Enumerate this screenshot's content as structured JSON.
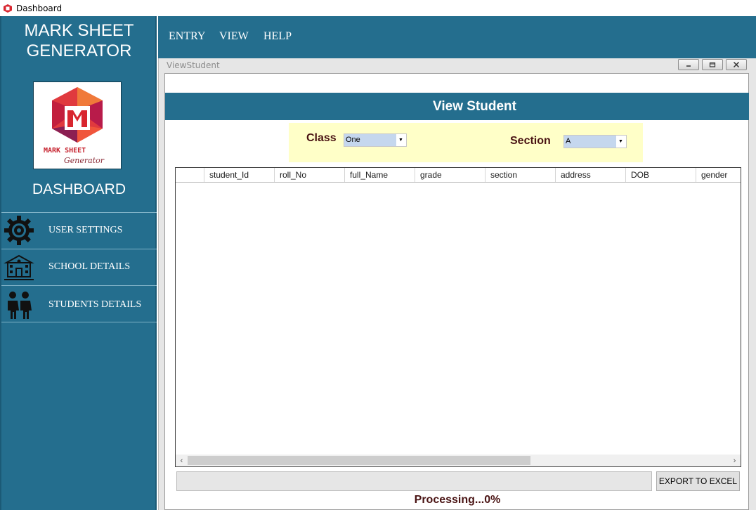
{
  "window": {
    "title": "Dashboard"
  },
  "sidebar": {
    "brand": "MARK SHEET GENERATOR",
    "logo": {
      "line1": "MARK SHEET",
      "line2": "Generator"
    },
    "dashboard_label": "DASHBOARD",
    "items": [
      {
        "label": "USER SETTINGS",
        "icon": "gear-icon"
      },
      {
        "label": "SCHOOL DETAILS",
        "icon": "school-icon"
      },
      {
        "label": "STUDENTS DETAILS",
        "icon": "students-icon"
      }
    ]
  },
  "menu": {
    "items": [
      "ENTRY",
      "VIEW",
      "HELP"
    ]
  },
  "child_window": {
    "title": "ViewStudent",
    "header": "View Student",
    "filters": {
      "class_label": "Class",
      "class_value": "One",
      "section_label": "Section",
      "section_value": "A"
    },
    "grid": {
      "columns": [
        "student_Id",
        "roll_No",
        "full_Name",
        "grade",
        "section",
        "address",
        "DOB",
        "gender"
      ],
      "rows": []
    },
    "export_label": "EXPORT TO EXCEL",
    "progress": 0,
    "status_text": "Processing...0%"
  },
  "colors": {
    "primary": "#246e8e",
    "panel": "#ffffc8",
    "label_text": "#4a1414"
  }
}
